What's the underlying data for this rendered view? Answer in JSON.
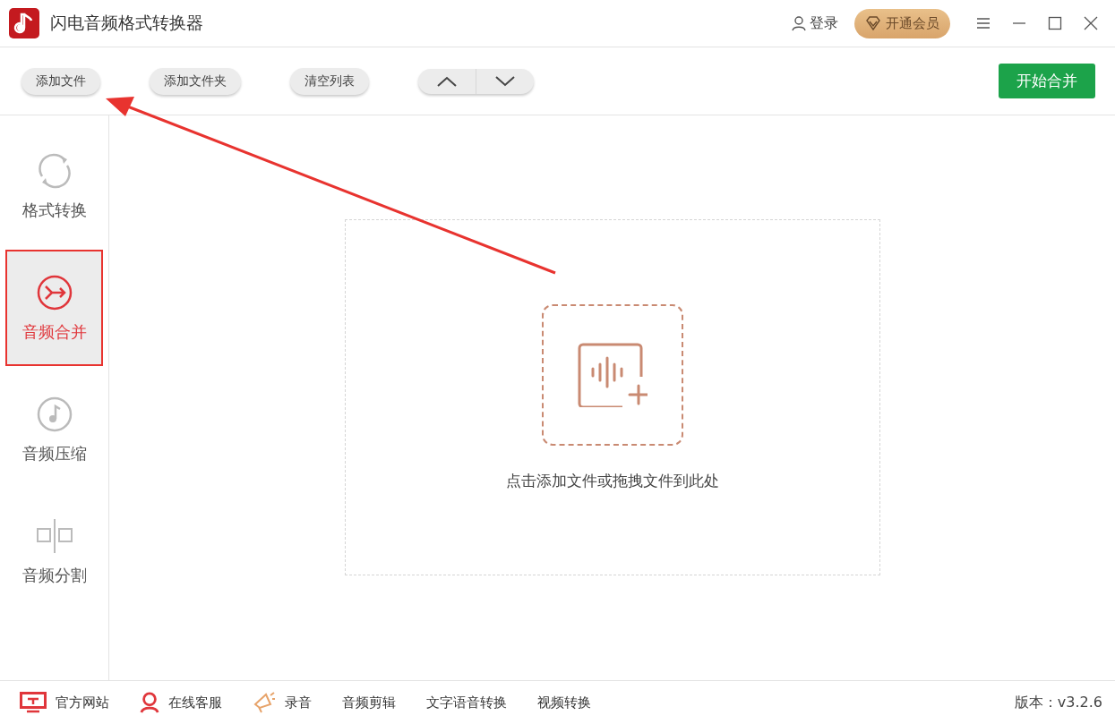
{
  "window": {
    "title": "闪电音频格式转换器"
  },
  "header": {
    "login": "登录",
    "vip": "开通会员"
  },
  "toolbar": {
    "buttons": [
      "添加文件",
      "添加文件夹",
      "清空列表"
    ],
    "start": "开始合并"
  },
  "sidebar": {
    "items": [
      {
        "label": "格式转换",
        "kind": "convert",
        "selected": false
      },
      {
        "label": "音频合并",
        "kind": "merge",
        "selected": true
      },
      {
        "label": "音频压缩",
        "kind": "compress",
        "selected": false
      },
      {
        "label": "音频分割",
        "kind": "split",
        "selected": false
      }
    ]
  },
  "dropzone": {
    "hint": "点击添加文件或拖拽文件到此处"
  },
  "annotation": {
    "arrow": true
  },
  "footer": {
    "items": [
      {
        "label": "官方网站",
        "kind": "monitor"
      },
      {
        "label": "在线客服",
        "kind": "person"
      },
      {
        "label": "录音",
        "kind": "megaphone"
      },
      {
        "label": "音频剪辑",
        "kind": "text"
      },
      {
        "label": "文字语音转换",
        "kind": "text"
      },
      {
        "label": "视频转换",
        "kind": "text"
      }
    ],
    "version": "版本：v3.2.6"
  }
}
